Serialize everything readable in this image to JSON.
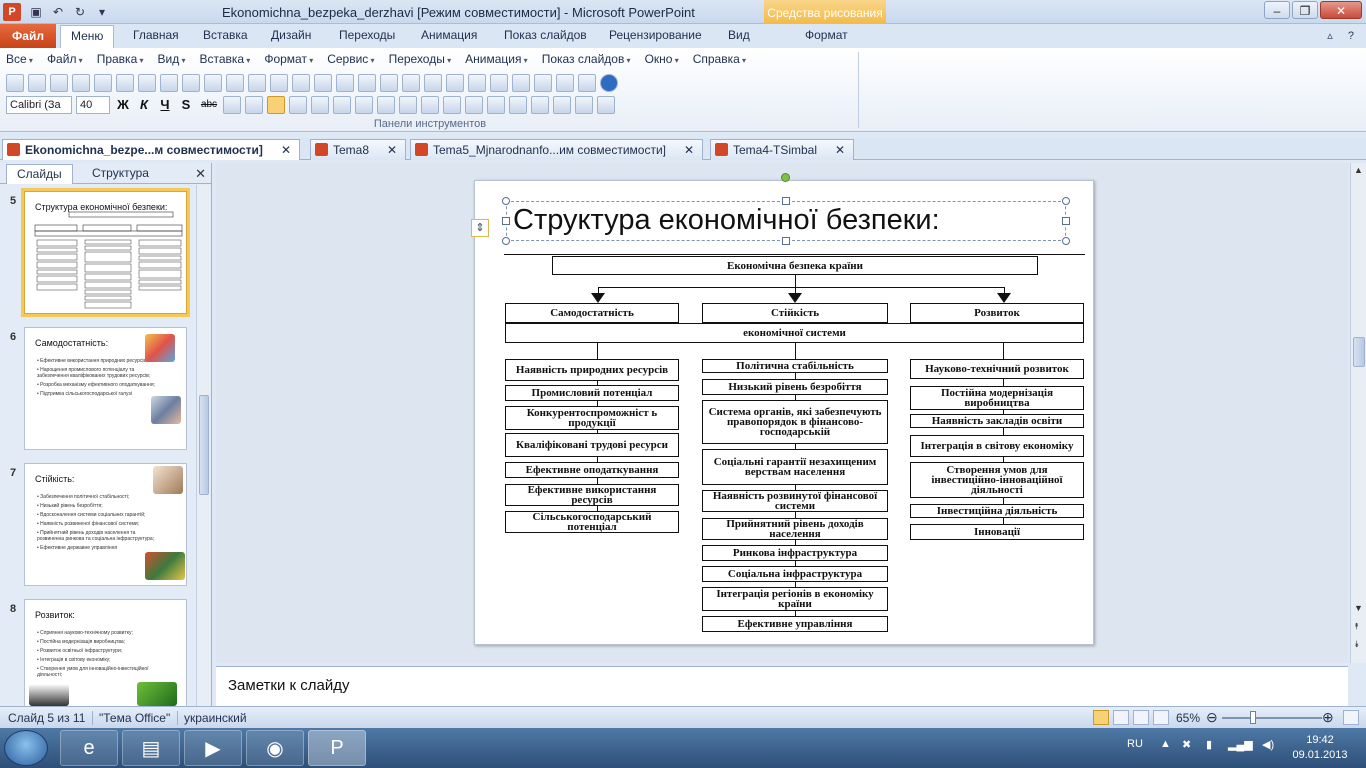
{
  "window": {
    "title": "Ekonomichna_bezpeka_derzhavi [Режим совместимости]  -  Microsoft PowerPoint",
    "context_tab": "Средства рисования",
    "app_icon": "P"
  },
  "ribbon_tabs": {
    "file": "Файл",
    "items": [
      "Меню",
      "Главная",
      "Вставка",
      "Дизайн",
      "Переходы",
      "Анимация",
      "Показ слайдов",
      "Рецензирование",
      "Вид",
      "Формат"
    ]
  },
  "menu_bar": [
    "Все",
    "Файл",
    "Правка",
    "Вид",
    "Вставка",
    "Формат",
    "Сервис",
    "Переходы",
    "Анимация",
    "Показ слайдов",
    "Окно",
    "Справка"
  ],
  "toolbar": {
    "font_name": "Calibri (За",
    "font_size": "40",
    "panel_caption": "Панели инструментов",
    "bold": "Ж",
    "italic": "К",
    "underline": "Ч",
    "shadow": "S",
    "strike": "abc"
  },
  "doc_tabs": [
    {
      "label": "Ekonomichna_bezpe...м совместимости]",
      "active": true
    },
    {
      "label": "Tema8",
      "active": false
    },
    {
      "label": "Tema5_Mjnarodnanfo...им совместимости]",
      "active": false
    },
    {
      "label": "Tema4-TSimbal",
      "active": false
    }
  ],
  "slides_pane": {
    "tab_slides": "Слайды",
    "tab_outline": "Структура",
    "thumbnails": [
      {
        "num": "5",
        "title": "Структура економічної безпеки:",
        "items": []
      },
      {
        "num": "6",
        "title": "Самодостатність:",
        "items": [
          "Ефективне використання природних ресурсів;",
          "Нарощення промислового потенціалу та забезпечення кваліфікованих трудових ресурсів;",
          "Розробка механізму ефективного оподаткування;",
          "Підтримка сільськогосподарської галузі"
        ]
      },
      {
        "num": "7",
        "title": "Стійкість:",
        "items": [
          "Забезпечення політичної стабільності;",
          "Низький рівень безробіття;",
          "Вдосконалення системи соціальних гарантій;",
          "Наявність розвиненої фінансової системи;",
          "Прийнятний рівень доходів населення та розвиненна ринкова та соціальна інфраструктура;",
          "Ефективне державне управління"
        ]
      },
      {
        "num": "8",
        "title": "Розвиток:",
        "items": [
          "Сприяння науково-технічному розвитку;",
          "Постійна модернізація виробництва;",
          "Розвиток освітньої інфраструктури;",
          "Інтеграція в світову економіку;",
          "Створення умов для інноваційно-інвестиційної діяльності;"
        ]
      }
    ]
  },
  "slide": {
    "title": "Структура економічної безпеки:",
    "root": "Економічна безпека країни",
    "columns": [
      "Самодостатність",
      "Стійкість",
      "Розвиток"
    ],
    "subtitle": "економічної системи",
    "col1": [
      "Наявність природних ресурсів",
      "Промисловий потенціал",
      "Конкурентоспроможніст ь продукції",
      "Кваліфіковані трудові ресурси",
      "Ефективне оподаткування",
      "Ефективне використання ресурсів",
      "Сільськогосподарський потенціал"
    ],
    "col2": [
      "Політична стабільність",
      "Низький рівень безробіття",
      "Система органів, які забезпечують правопорядок в фінансово-господарській",
      "Соціальні гарантії незахищеним верствам населення",
      "Наявність розвинутої фінансової системи",
      "Прийнятний рівень доходів населення",
      "Ринкова інфраструктура",
      "Соціальна інфраструктура",
      "Інтеграція регіонів в економіку країни",
      "Ефективне управління"
    ],
    "col3": [
      "Науково-технічний розвиток",
      "Постійна модернізація виробництва",
      "Наявність закладів освіти",
      "Інтеграція в світову економіку",
      "Створення умов для інвестиційно-інноваційної діяльності",
      "Інвестиційна діяльність",
      "Інновації"
    ]
  },
  "notes_placeholder": "Заметки к слайду",
  "status": {
    "slide_info": "Слайд 5 из 11",
    "theme": "\"Тема Office\"",
    "language": "украинский",
    "zoom": "65%",
    "zoom_fraction": 0.65
  },
  "taskbar": {
    "lang": "RU",
    "time": "19:42",
    "date": "09.01.2013"
  }
}
